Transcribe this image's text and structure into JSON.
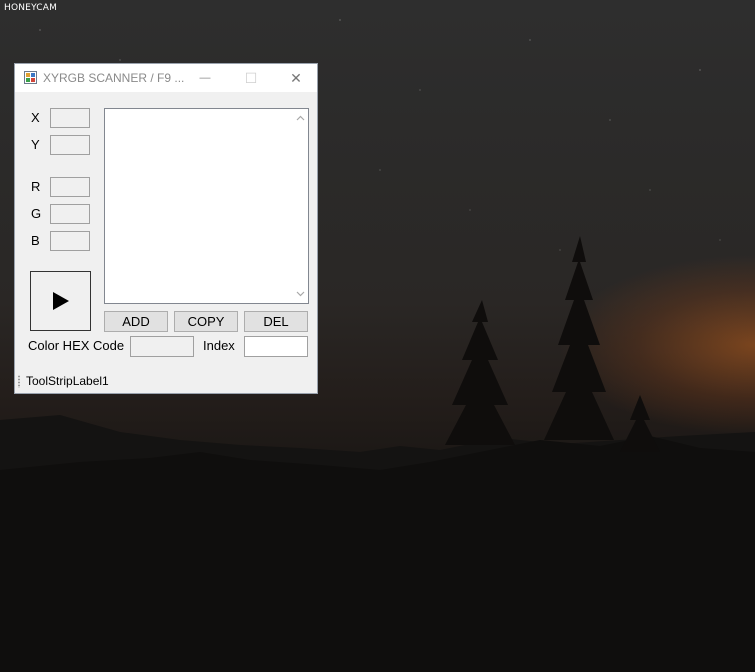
{
  "watermark": "HONEYCAM",
  "window": {
    "title": "XYRGB SCANNER / F9 ...",
    "minimize_glyph": "—",
    "maximize_glyph": "☐",
    "close_glyph": "✕"
  },
  "fields": {
    "x_label": "X",
    "y_label": "Y",
    "r_label": "R",
    "g_label": "G",
    "b_label": "B",
    "x_value": "",
    "y_value": "",
    "r_value": "",
    "g_value": "",
    "b_value": ""
  },
  "list": {
    "items": []
  },
  "buttons": {
    "add": "ADD",
    "copy": "COPY",
    "del": "DEL",
    "play_icon": "play-icon"
  },
  "hex": {
    "label": "Color HEX Code",
    "value": ""
  },
  "index": {
    "label": "Index",
    "value": ""
  },
  "status": {
    "label": "ToolStripLabel1"
  }
}
